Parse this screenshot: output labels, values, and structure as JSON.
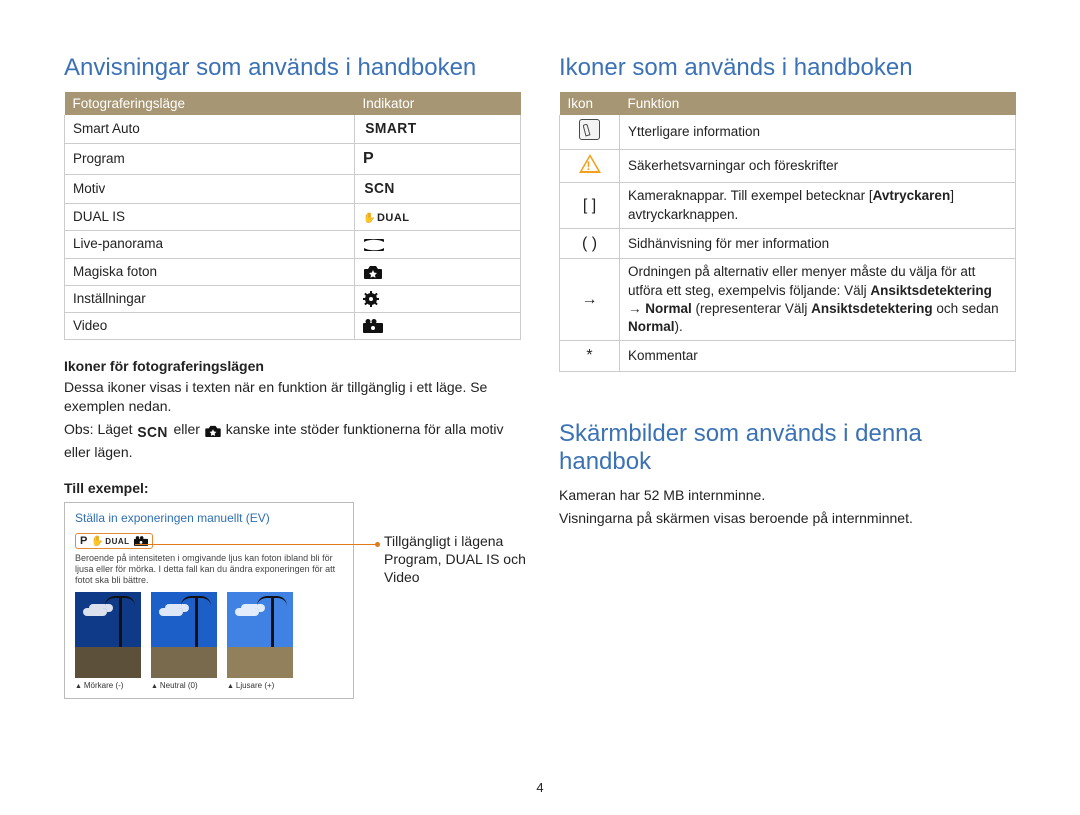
{
  "left": {
    "heading": "Anvisningar som används i handboken",
    "table": {
      "col1": "Fotograferingsläge",
      "col2": "Indikator",
      "rows": [
        {
          "mode": "Smart Auto",
          "ind": "SMART"
        },
        {
          "mode": "Program",
          "ind": "P"
        },
        {
          "mode": "Motiv",
          "ind": "SCN"
        },
        {
          "mode": "DUAL IS",
          "ind": "DUAL"
        },
        {
          "mode": "Live-panorama",
          "ind": "panorama-icon"
        },
        {
          "mode": "Magiska foton",
          "ind": "magic-icon"
        },
        {
          "mode": "Inställningar",
          "ind": "gear-icon"
        },
        {
          "mode": "Video",
          "ind": "video-icon"
        }
      ]
    },
    "sub1_title": "Ikoner för fotograferingslägen",
    "sub1_line1": "Dessa ikoner visas i texten när en funktion är tillgänglig i ett läge. Se exemplen nedan.",
    "sub1_line2a": "Obs: Läget ",
    "sub1_line2b": " eller ",
    "sub1_line2c": " kanske inte stöder funktionerna för alla motiv eller lägen.",
    "sub2_title": "Till exempel:",
    "example": {
      "title": "Ställa in exponeringen manuellt (EV)",
      "desc": "Beroende på intensiteten i omgivande ljus kan foton ibland bli för ljusa eller för mörka. I detta fall kan du ändra exponeringen för att fotot ska bli bättre.",
      "caps": [
        "Mörkare (-)",
        "Neutral (0)",
        "Ljusare (+)"
      ]
    },
    "callout": "Tillgängligt i lägena Program, DUAL IS och Video"
  },
  "right": {
    "heading1": "Ikoner som används i handboken",
    "table": {
      "col1": "Ikon",
      "col2": "Funktion",
      "rows": {
        "info": "Ytterligare information",
        "warn": "Säkerhetsvarningar och föreskrifter",
        "bracket_a": "Kameraknappar. Till exempel betecknar [",
        "bracket_bold": "Avtryckaren",
        "bracket_b": "] avtryckarknappen.",
        "paren": "Sidhänvisning för mer information",
        "arrow_a": "Ordningen på alternativ eller menyer måste du välja för att utföra ett steg, exempelvis följande: Välj ",
        "arrow_b1": "Ansiktsdetektering",
        "arrow_b2": " → ",
        "arrow_b3": "Normal",
        "arrow_c": " (representerar Välj ",
        "arrow_d1": "Ansiktsdetektering",
        "arrow_d2": " och sedan ",
        "arrow_d3": "Normal",
        "arrow_e": ").",
        "star": "Kommentar"
      },
      "icon_labels": {
        "bracket": "[    ]",
        "paren": "(   )",
        "arrow": "→",
        "star": "*"
      }
    },
    "heading2": "Skärmbilder som används i denna handbok",
    "p1": "Kameran har 52 MB internminne.",
    "p2": "Visningarna på skärmen visas beroende på internminnet."
  },
  "page_number": "4"
}
